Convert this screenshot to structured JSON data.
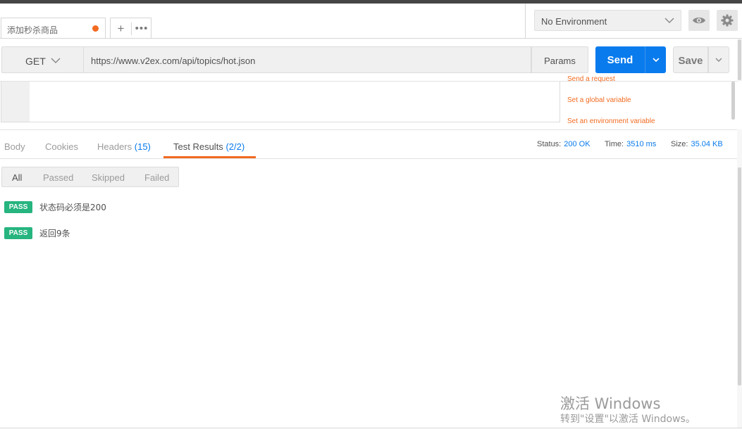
{
  "tab": {
    "title": "添加秒杀商品",
    "add_label": "+",
    "more_label": "•••"
  },
  "environment": {
    "selected": "No Environment"
  },
  "request": {
    "method": "GET",
    "url": "https://www.v2ex.com/api/topics/hot.json",
    "params_label": "Params",
    "send_label": "Send",
    "save_label": "Save"
  },
  "snippets": [
    "Send a request",
    "Set a global variable",
    "Set an environment variable"
  ],
  "response": {
    "tabs": [
      {
        "label": "Body",
        "count": ""
      },
      {
        "label": "Cookies",
        "count": ""
      },
      {
        "label": "Headers",
        "count": "(15)"
      },
      {
        "label": "Test Results",
        "count": "(2/2)"
      }
    ],
    "status_label": "Status:",
    "status_value": "200 OK",
    "time_label": "Time:",
    "time_value": "3510 ms",
    "size_label": "Size:",
    "size_value": "35.04 KB"
  },
  "filters": [
    "All",
    "Passed",
    "Skipped",
    "Failed"
  ],
  "results": [
    {
      "badge": "PASS",
      "name": "状态码必须是200"
    },
    {
      "badge": "PASS",
      "name": "返回9条"
    }
  ],
  "watermark": {
    "title": "激活 Windows",
    "subtitle": "转到\"设置\"以激活 Windows。"
  },
  "colors": {
    "accent": "#f26b21",
    "primary": "#097bed",
    "pass": "#26b47f"
  }
}
